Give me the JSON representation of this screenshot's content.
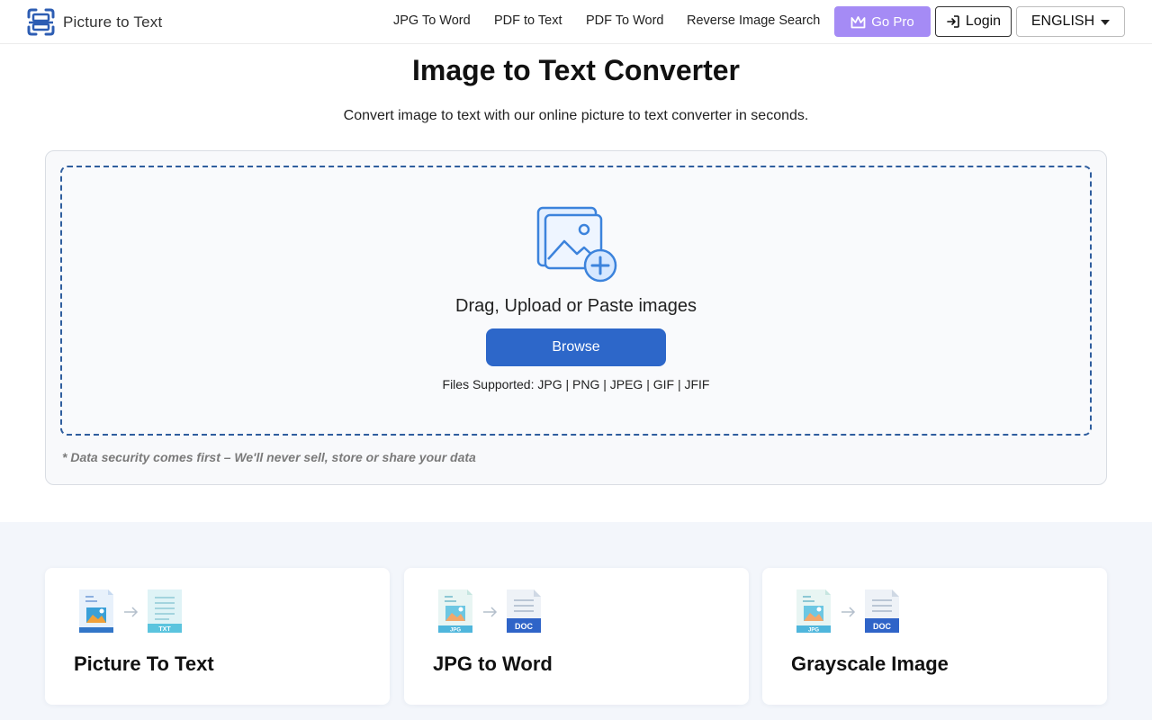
{
  "header": {
    "logo_text": "Picture to Text",
    "nav": [
      "JPG To Word",
      "PDF to Text",
      "PDF To Word",
      "Reverse Image Search"
    ],
    "go_pro": "Go Pro",
    "login": "Login",
    "language": "ENGLISH"
  },
  "hero": {
    "title": "Image to Text Converter",
    "subtitle": "Convert image to text with our online picture to text converter in seconds."
  },
  "upload": {
    "drop_text": "Drag, Upload or Paste images",
    "browse": "Browse",
    "files_supported": "Files Supported: JPG | PNG | JPEG | GIF | JFIF",
    "security_note": "* Data security comes first – We'll never sell, store or share your data"
  },
  "tools": [
    {
      "title": "Picture To Text",
      "target_badge": "TXT",
      "source_badge": ""
    },
    {
      "title": "JPG to Word",
      "target_badge": "DOC",
      "source_badge": "JPG"
    },
    {
      "title": "Grayscale Image",
      "target_badge": "DOC",
      "source_badge": "JPG"
    }
  ],
  "colors": {
    "brand_blue": "#2d67c9",
    "pro_purple": "#a58bf5",
    "dropzone_border": "#2f5e9e",
    "section_bg": "#f3f6fb"
  },
  "icons": [
    "scan-logo-icon",
    "crown-icon",
    "login-arrow-icon",
    "caret-down-icon",
    "image-add-icon",
    "image-file-icon",
    "arrow-right-icon",
    "text-file-icon",
    "doc-file-icon"
  ]
}
